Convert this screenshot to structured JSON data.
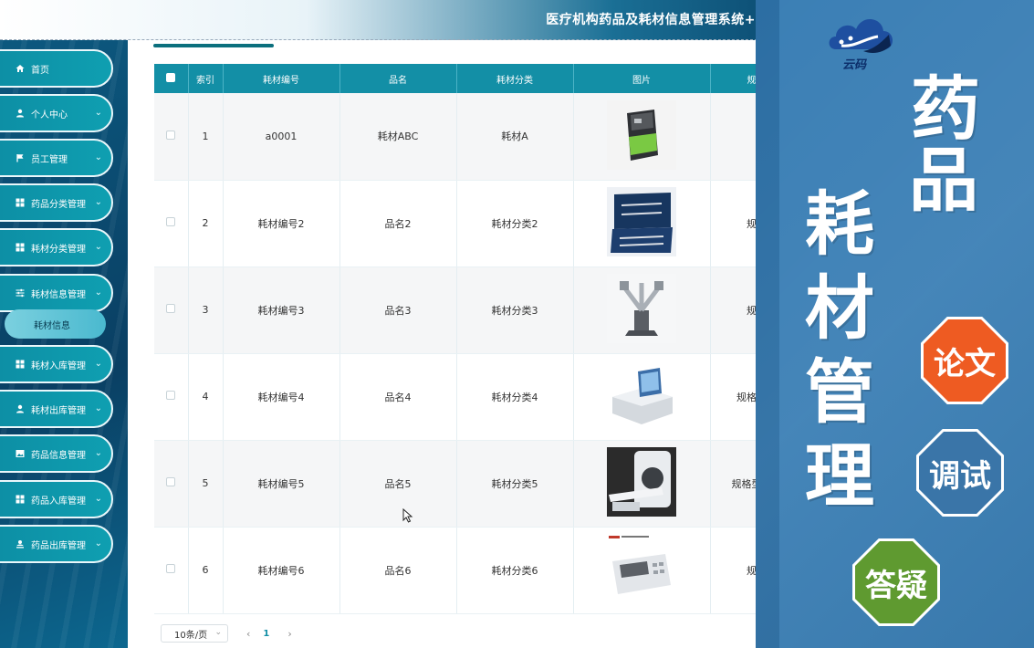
{
  "app": {
    "title": "医疗机构药品及耗材信息管理系统+"
  },
  "sidebar": {
    "items": [
      {
        "label": "首页",
        "icon": "home-icon",
        "expandable": false
      },
      {
        "label": "个人中心",
        "icon": "user-icon",
        "expandable": true
      },
      {
        "label": "员工管理",
        "icon": "flag-icon",
        "expandable": true
      },
      {
        "label": "药品分类管理",
        "icon": "grid-icon",
        "expandable": true
      },
      {
        "label": "耗材分类管理",
        "icon": "grid-icon",
        "expandable": true
      },
      {
        "label": "耗材信息管理",
        "icon": "sliders-icon",
        "expandable": true
      },
      {
        "label": "耗材入库管理",
        "icon": "grid-icon",
        "expandable": true
      },
      {
        "label": "耗材出库管理",
        "icon": "user-icon",
        "expandable": true
      },
      {
        "label": "药品信息管理",
        "icon": "image-icon",
        "expandable": true
      },
      {
        "label": "药品入库管理",
        "icon": "grid-icon",
        "expandable": true
      },
      {
        "label": "药品出库管理",
        "icon": "user-upload-icon",
        "expandable": true
      }
    ],
    "active_sub": "耗材信息"
  },
  "table": {
    "headers": [
      "索引",
      "耗材编号",
      "品名",
      "耗材分类",
      "图片",
      "规"
    ],
    "rows": [
      {
        "index": "1",
        "code": "a0001",
        "name": "耗材ABC",
        "category": "耗材A",
        "image": "device-console-image",
        "spec": ""
      },
      {
        "index": "2",
        "code": "耗材编号2",
        "name": "品名2",
        "category": "耗材分类2",
        "image": "instrument-case-image",
        "spec": "规"
      },
      {
        "index": "3",
        "code": "耗材编号3",
        "name": "品名3",
        "category": "耗材分类3",
        "image": "surgical-robot-image",
        "spec": "规"
      },
      {
        "index": "4",
        "code": "耗材编号4",
        "name": "品名4",
        "category": "耗材分类4",
        "image": "analyzer-image",
        "spec": "规格型"
      },
      {
        "index": "5",
        "code": "耗材编号5",
        "name": "品名5",
        "category": "耗材分类5",
        "image": "ct-scanner-image",
        "spec": "规格型号"
      },
      {
        "index": "6",
        "code": "耗材编号6",
        "name": "品名6",
        "category": "耗材分类6",
        "image": "ecg-monitor-image",
        "spec": "规"
      }
    ]
  },
  "pagination": {
    "page_size": "10条/页",
    "current_page": "1"
  },
  "promo": {
    "logo_text": "云码",
    "vertical_top": "药",
    "vertical_second": "品",
    "vertical_column": [
      "耗",
      "材",
      "管",
      "理"
    ],
    "badges": {
      "paper": "论文",
      "debug": "调试",
      "qa": "答疑"
    },
    "colors": {
      "paper": "#ee5b22",
      "debug": "#3a75a8",
      "qa": "#5f9a30"
    }
  },
  "colors": {
    "primary": "#138fa6",
    "sidebar_item": "#0f9fb1",
    "sidebar_sub": "#7bd0df"
  }
}
